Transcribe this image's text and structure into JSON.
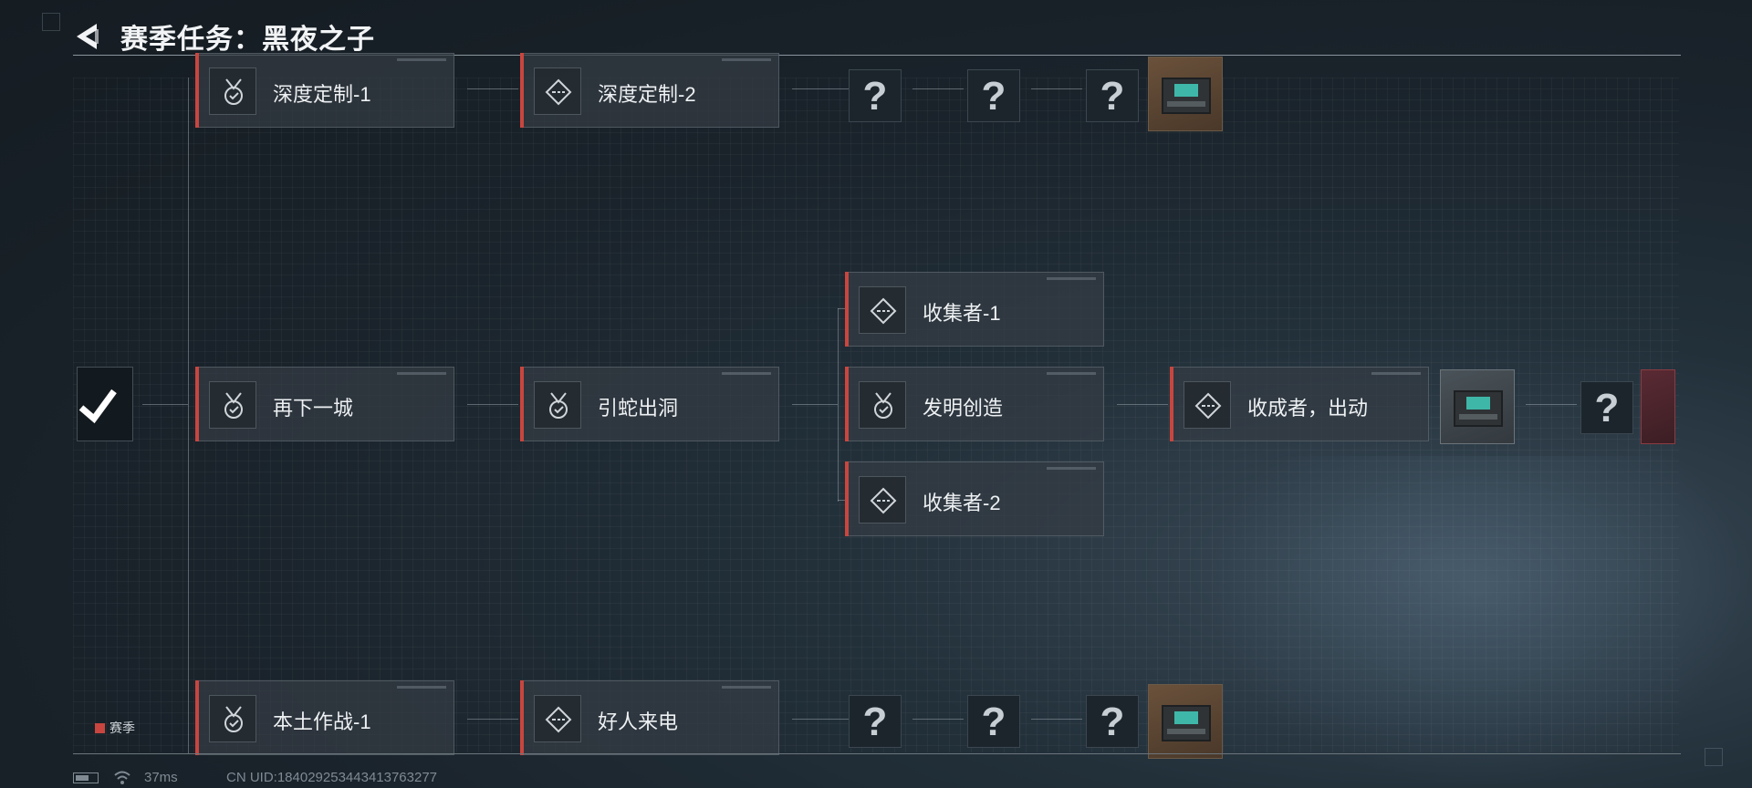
{
  "header": {
    "title": "赛季任务：黑夜之子"
  },
  "legend": {
    "label": "赛季",
    "color": "#c8463f"
  },
  "status": {
    "ping": "37ms",
    "uid": "CN UID:184029253443413763277"
  },
  "accent_color": "#c8463f",
  "nodes": {
    "depth1": {
      "label": "深度定制-1",
      "icon": "medal-check-icon"
    },
    "depth2": {
      "label": "深度定制-2",
      "icon": "diamond-dashes-icon"
    },
    "city": {
      "label": "再下一城",
      "icon": "medal-check-icon"
    },
    "snake": {
      "label": "引蛇出洞",
      "icon": "medal-check-icon"
    },
    "collector1": {
      "label": "收集者-1",
      "icon": "diamond-dashes-icon"
    },
    "invent": {
      "label": "发明创造",
      "icon": "medal-check-icon"
    },
    "collector2": {
      "label": "收集者-2",
      "icon": "diamond-dashes-icon"
    },
    "harvest": {
      "label": "收成者，出动",
      "icon": "diamond-dashes-icon"
    },
    "local": {
      "label": "本土作战-1",
      "icon": "medal-check-icon"
    },
    "call": {
      "label": "好人来电",
      "icon": "diamond-dashes-icon"
    }
  },
  "locked_symbol": "?"
}
